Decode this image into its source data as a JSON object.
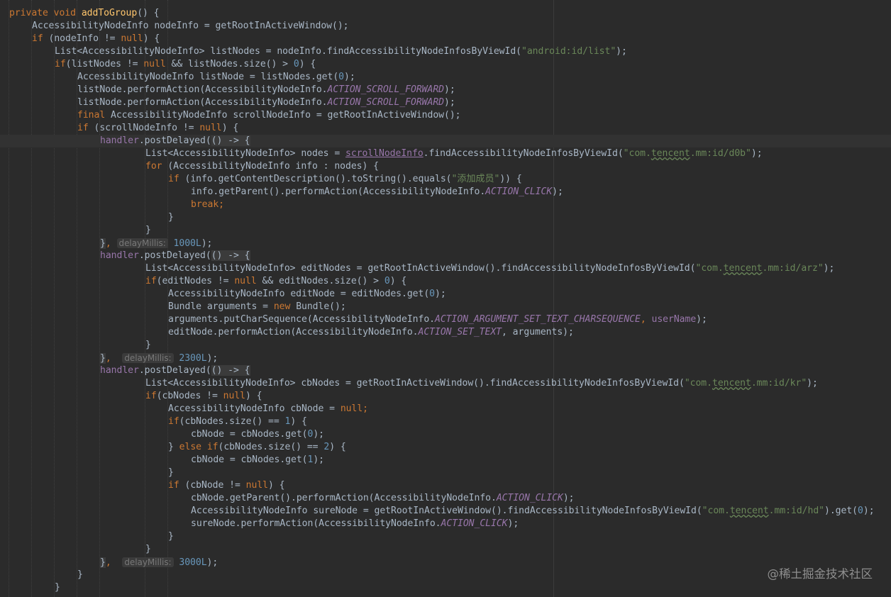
{
  "editor": {
    "background": "#2b2b2b",
    "current_line_background": "#323232"
  },
  "colors": {
    "keyword": "#cc7832",
    "method": "#ffc66d",
    "string": "#6a8759",
    "number": "#6897bb",
    "field": "#9876aa",
    "text": "#a9b7c6",
    "hint": "#787878"
  },
  "watermark": "@稀土掘金技术社区",
  "lines": [
    {
      "indent": 0,
      "tokens": [
        [
          "private void ",
          "kw"
        ],
        [
          "addToGroup",
          "fn"
        ],
        [
          "() {",
          ""
        ]
      ]
    },
    {
      "indent": 1,
      "tokens": [
        [
          "AccessibilityNodeInfo nodeInfo = getRootInActiveWindow();",
          ""
        ]
      ]
    },
    {
      "indent": 1,
      "tokens": [
        [
          "if ",
          "kw"
        ],
        [
          "(nodeInfo != ",
          ""
        ],
        [
          "null",
          "kw"
        ],
        [
          ") {",
          ""
        ]
      ]
    },
    {
      "indent": 2,
      "tokens": [
        [
          "List<AccessibilityNodeInfo> listNodes = nodeInfo.findAccessibilityNodeInfosByViewId(",
          ""
        ],
        [
          "\"android:id/list\"",
          "str"
        ],
        [
          ");",
          ""
        ]
      ]
    },
    {
      "indent": 2,
      "tokens": [
        [
          "if",
          "kw"
        ],
        [
          "(listNodes != ",
          ""
        ],
        [
          "null ",
          "kw"
        ],
        [
          "&& listNodes.size() > ",
          ""
        ],
        [
          "0",
          "num"
        ],
        [
          ") {",
          ""
        ]
      ]
    },
    {
      "indent": 3,
      "tokens": [
        [
          "AccessibilityNodeInfo listNode = listNodes.get(",
          ""
        ],
        [
          "0",
          "num"
        ],
        [
          ");",
          ""
        ]
      ]
    },
    {
      "indent": 3,
      "tokens": [
        [
          "listNode.performAction(AccessibilityNodeInfo.",
          ""
        ],
        [
          "ACTION_SCROLL_FORWARD",
          "field"
        ],
        [
          ");",
          ""
        ]
      ]
    },
    {
      "indent": 3,
      "tokens": [
        [
          "listNode.performAction(AccessibilityNodeInfo.",
          ""
        ],
        [
          "ACTION_SCROLL_FORWARD",
          "field"
        ],
        [
          ");",
          ""
        ]
      ]
    },
    {
      "indent": 3,
      "tokens": [
        [
          "final ",
          "kw"
        ],
        [
          "AccessibilityNodeInfo scrollNodeInfo = getRootInActiveWindow();",
          ""
        ]
      ]
    },
    {
      "indent": 3,
      "tokens": [
        [
          "if ",
          "kw"
        ],
        [
          "(scrollNodeInfo != ",
          ""
        ],
        [
          "null",
          "kw"
        ],
        [
          ") {",
          ""
        ]
      ]
    },
    {
      "indent": 4,
      "highlight": true,
      "tokens": [
        [
          "handler",
          "mem"
        ],
        [
          ".postDelayed(",
          ""
        ],
        [
          "() -> {",
          "lam"
        ]
      ]
    },
    {
      "indent": 6,
      "tokens": [
        [
          "List<AccessibilityNodeInfo> nodes = ",
          ""
        ],
        [
          "scrollNodeInfo",
          "mem und"
        ],
        [
          ".findAccessibilityNodeInfosByViewId(",
          ""
        ],
        [
          "\"com.",
          "str"
        ],
        [
          "tencent",
          "str typo"
        ],
        [
          ".mm:id/d0b\"",
          "str"
        ],
        [
          ");",
          ""
        ]
      ]
    },
    {
      "indent": 6,
      "tokens": [
        [
          "for ",
          "kw"
        ],
        [
          "(AccessibilityNodeInfo info : nodes) {",
          ""
        ]
      ]
    },
    {
      "indent": 7,
      "tokens": [
        [
          "if ",
          "kw"
        ],
        [
          "(info.getContentDescription().toString().equals(",
          ""
        ],
        [
          "\"添加成员\"",
          "str"
        ],
        [
          ")) {",
          ""
        ]
      ]
    },
    {
      "indent": 8,
      "tokens": [
        [
          "info.getParent().performAction(AccessibilityNodeInfo.",
          ""
        ],
        [
          "ACTION_CLICK",
          "field"
        ],
        [
          ");",
          ""
        ]
      ]
    },
    {
      "indent": 8,
      "tokens": [
        [
          "break",
          "kw"
        ],
        [
          ";",
          "kw"
        ]
      ]
    },
    {
      "indent": 7,
      "tokens": [
        [
          "}",
          ""
        ]
      ]
    },
    {
      "indent": 6,
      "tokens": [
        [
          "}",
          ""
        ]
      ]
    },
    {
      "indent": 4,
      "tokens": [
        [
          "}",
          "lam"
        ],
        [
          ", ",
          "kw"
        ],
        [
          "delayMillis:",
          "hint"
        ],
        [
          " ",
          ""
        ],
        [
          "1000L",
          "num"
        ],
        [
          ");",
          ""
        ]
      ]
    },
    {
      "indent": 4,
      "tokens": [
        [
          "handler",
          "mem"
        ],
        [
          ".postDelayed(",
          ""
        ],
        [
          "() -> {",
          "lam"
        ]
      ]
    },
    {
      "indent": 6,
      "tokens": [
        [
          "List<AccessibilityNodeInfo> editNodes = getRootInActiveWindow().findAccessibilityNodeInfosByViewId(",
          ""
        ],
        [
          "\"com.",
          "str"
        ],
        [
          "tencent",
          "str typo"
        ],
        [
          ".mm:id/arz\"",
          "str"
        ],
        [
          ");",
          ""
        ]
      ]
    },
    {
      "indent": 6,
      "tokens": [
        [
          "if",
          "kw"
        ],
        [
          "(editNodes != ",
          ""
        ],
        [
          "null ",
          "kw"
        ],
        [
          "&& editNodes.size() > ",
          ""
        ],
        [
          "0",
          "num"
        ],
        [
          ") {",
          ""
        ]
      ]
    },
    {
      "indent": 7,
      "tokens": [
        [
          "AccessibilityNodeInfo editNode = editNodes.get(",
          ""
        ],
        [
          "0",
          "num"
        ],
        [
          ");",
          ""
        ]
      ]
    },
    {
      "indent": 7,
      "tokens": [
        [
          "Bundle arguments = ",
          ""
        ],
        [
          "new ",
          "kw"
        ],
        [
          "Bundle();",
          ""
        ]
      ]
    },
    {
      "indent": 7,
      "tokens": [
        [
          "arguments.putCharSequence(AccessibilityNodeInfo.",
          ""
        ],
        [
          "ACTION_ARGUMENT_SET_TEXT_CHARSEQUENCE",
          "field"
        ],
        [
          ", ",
          "kw"
        ],
        [
          "userName",
          "mem"
        ],
        [
          ");",
          ""
        ]
      ]
    },
    {
      "indent": 7,
      "tokens": [
        [
          "editNode.performAction(AccessibilityNodeInfo.",
          ""
        ],
        [
          "ACTION_SET_TEXT",
          "field"
        ],
        [
          ", arguments);",
          ""
        ]
      ]
    },
    {
      "indent": 6,
      "tokens": [
        [
          "}",
          ""
        ]
      ]
    },
    {
      "indent": 4,
      "tokens": [
        [
          "}",
          "lam"
        ],
        [
          ",  ",
          "kw"
        ],
        [
          "delayMillis:",
          "hint"
        ],
        [
          " ",
          ""
        ],
        [
          "2300L",
          "num"
        ],
        [
          ");",
          ""
        ]
      ]
    },
    {
      "indent": 4,
      "tokens": [
        [
          "handler",
          "mem"
        ],
        [
          ".postDelayed(",
          ""
        ],
        [
          "() -> {",
          "lam"
        ]
      ]
    },
    {
      "indent": 6,
      "tokens": [
        [
          "List<AccessibilityNodeInfo> cbNodes = getRootInActiveWindow().findAccessibilityNodeInfosByViewId(",
          ""
        ],
        [
          "\"com.",
          "str"
        ],
        [
          "tencent",
          "str typo"
        ],
        [
          ".mm:id/kr\"",
          "str"
        ],
        [
          ");",
          ""
        ]
      ]
    },
    {
      "indent": 6,
      "tokens": [
        [
          "if",
          "kw"
        ],
        [
          "(cbNodes != ",
          ""
        ],
        [
          "null",
          "kw"
        ],
        [
          ") {",
          ""
        ]
      ]
    },
    {
      "indent": 7,
      "tokens": [
        [
          "AccessibilityNodeInfo cbNode = ",
          ""
        ],
        [
          "null",
          "kw"
        ],
        [
          ";",
          "kw"
        ]
      ]
    },
    {
      "indent": 7,
      "tokens": [
        [
          "if",
          "kw"
        ],
        [
          "(cbNodes.size() == ",
          ""
        ],
        [
          "1",
          "num"
        ],
        [
          ") {",
          ""
        ]
      ]
    },
    {
      "indent": 8,
      "tokens": [
        [
          "cbNode = cbNodes.get(",
          ""
        ],
        [
          "0",
          "num"
        ],
        [
          ");",
          ""
        ]
      ]
    },
    {
      "indent": 7,
      "tokens": [
        [
          "} ",
          ""
        ],
        [
          "else if",
          "kw"
        ],
        [
          "(cbNodes.size() == ",
          ""
        ],
        [
          "2",
          "num"
        ],
        [
          ") {",
          ""
        ]
      ]
    },
    {
      "indent": 8,
      "tokens": [
        [
          "cbNode = cbNodes.get(",
          ""
        ],
        [
          "1",
          "num"
        ],
        [
          ");",
          ""
        ]
      ]
    },
    {
      "indent": 7,
      "tokens": [
        [
          "}",
          ""
        ]
      ]
    },
    {
      "indent": 7,
      "tokens": [
        [
          "if ",
          "kw"
        ],
        [
          "(cbNode != ",
          ""
        ],
        [
          "null",
          "kw"
        ],
        [
          ") {",
          ""
        ]
      ]
    },
    {
      "indent": 8,
      "tokens": [
        [
          "cbNode.getParent().performAction(AccessibilityNodeInfo.",
          ""
        ],
        [
          "ACTION_CLICK",
          "field"
        ],
        [
          ");",
          ""
        ]
      ]
    },
    {
      "indent": 8,
      "tokens": [
        [
          "AccessibilityNodeInfo sureNode = getRootInActiveWindow().findAccessibilityNodeInfosByViewId(",
          ""
        ],
        [
          "\"com.",
          "str"
        ],
        [
          "tencent",
          "str typo"
        ],
        [
          ".mm:id/hd\"",
          "str"
        ],
        [
          ").get(",
          ""
        ],
        [
          "0",
          "num"
        ],
        [
          ");",
          ""
        ]
      ]
    },
    {
      "indent": 8,
      "tokens": [
        [
          "sureNode.performAction(AccessibilityNodeInfo.",
          ""
        ],
        [
          "ACTION_CLICK",
          "field"
        ],
        [
          ");",
          ""
        ]
      ]
    },
    {
      "indent": 7,
      "tokens": [
        [
          "}",
          ""
        ]
      ]
    },
    {
      "indent": 6,
      "tokens": [
        [
          "}",
          ""
        ]
      ]
    },
    {
      "indent": 4,
      "tokens": [
        [
          "}",
          "lam"
        ],
        [
          ",  ",
          "kw"
        ],
        [
          "delayMillis:",
          "hint"
        ],
        [
          " ",
          ""
        ],
        [
          "3000L",
          "num"
        ],
        [
          ");",
          ""
        ]
      ]
    },
    {
      "indent": 3,
      "tokens": [
        [
          "}",
          ""
        ]
      ]
    },
    {
      "indent": 2,
      "tokens": [
        [
          "}",
          ""
        ]
      ]
    }
  ]
}
